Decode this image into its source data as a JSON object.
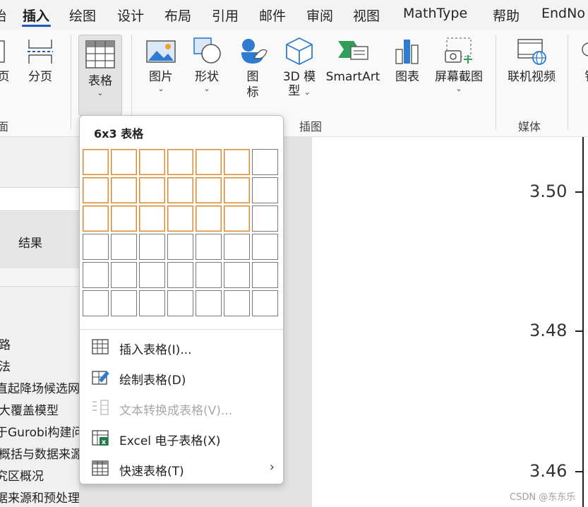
{
  "tabs": [
    {
      "label": "始"
    },
    {
      "label": "插入"
    },
    {
      "label": "绘图"
    },
    {
      "label": "设计"
    },
    {
      "label": "布局"
    },
    {
      "label": "引用"
    },
    {
      "label": "邮件"
    },
    {
      "label": "审阅"
    },
    {
      "label": "视图"
    },
    {
      "label": "MathType"
    },
    {
      "label": "帮助"
    },
    {
      "label": "EndNo"
    }
  ],
  "ribbon": {
    "page_partial": "页",
    "page_break": "分页",
    "pages_group_partial": "面",
    "table": "表格",
    "picture": "图片",
    "shapes": "形状",
    "icons_l1": "图",
    "icons_l2": "标",
    "model3d_l1": "3D 模",
    "model3d_l2": "型",
    "smartart": "SmartArt",
    "chart": "图表",
    "screenshot": "屏幕截图",
    "online_video": "联机视频",
    "more_partial": "铂",
    "group_illustrations": "插图",
    "group_media": "媒体",
    "chevron": "⌄",
    "accent": "#185abd"
  },
  "nav": {
    "result_label": "结果",
    "items": [
      {
        "label": "路"
      },
      {
        "label": "法"
      },
      {
        "label": "直起降场候选网"
      },
      {
        "label": "大覆盖模型"
      },
      {
        "label": "于Gurobi构建问"
      },
      {
        "label": "概括与数据来源"
      },
      {
        "label": "究区概况"
      },
      {
        "label": "据来源和预处理"
      }
    ]
  },
  "dropdown": {
    "title": "6x3 表格",
    "grid_cols": 7,
    "grid_rows": 6,
    "selected_cols": 6,
    "selected_rows": 3,
    "highlight_color": "#d28a37",
    "items": [
      {
        "label": "插入表格(I)...",
        "icon": "table-grid-icon",
        "enabled": true
      },
      {
        "label": "绘制表格(D)",
        "icon": "draw-table-icon",
        "enabled": true
      },
      {
        "label": "文本转换成表格(V)...",
        "icon": "convert-text-icon",
        "enabled": false
      },
      {
        "label": "Excel 电子表格(X)",
        "icon": "excel-icon",
        "enabled": true
      },
      {
        "label": "快速表格(T)",
        "icon": "quick-table-icon",
        "enabled": true,
        "submenu": "›"
      }
    ]
  },
  "document": {
    "y_ticks": [
      "3.50",
      "3.48",
      "3.46"
    ]
  },
  "watermark": "CSDN @东东乐"
}
